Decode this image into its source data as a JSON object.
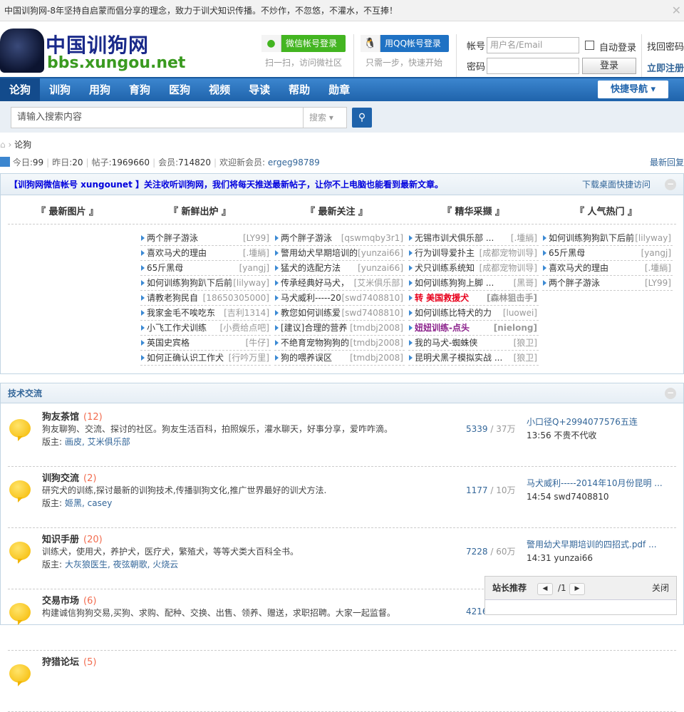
{
  "topbar": {
    "text": "中国训狗网-8年坚持自启蒙而倡分享的理念，致力于训犬知识传播。不炒作，不忽悠，不灌水，不互捧！"
  },
  "logo": {
    "cn": "中国训狗网",
    "domain": "bbs.xungou.net"
  },
  "social": {
    "wechat": "微信帐号登录",
    "wechat_sub": "扫一扫，访问微社区",
    "qq": "用QQ帐号登录",
    "qq_sub": "只需一步，快速开始"
  },
  "login": {
    "user_label": "帐号",
    "user_placeholder": "用户名/Email",
    "pass_label": "密码",
    "auto": "自动登录",
    "submit": "登录",
    "forgot": "找回密码",
    "register": "立即注册"
  },
  "nav": {
    "items": [
      "论狗",
      "训狗",
      "用狗",
      "育狗",
      "医狗",
      "视频",
      "导读",
      "帮助",
      "勋章"
    ],
    "quick": "快捷导航"
  },
  "search": {
    "placeholder": "请输入搜索内容",
    "type": "搜索"
  },
  "breadcrumb": {
    "current": "论狗"
  },
  "stats": {
    "today_label": "今日:",
    "today": "99",
    "yest_label": "昨日:",
    "yest": "20",
    "posts_label": "帖子:",
    "posts": "1969660",
    "members_label": "会员:",
    "members": "714820",
    "welcome": "欢迎新会员:",
    "newest": "ergeg98789",
    "latest": "最新回复"
  },
  "notice": {
    "text": "【训狗网微信帐号 xungounet 】关注收听训狗网，我们将每天推送最新帖子，让你不上电脑也能看到最新文章。",
    "download": "下载桌面快捷访问"
  },
  "columns": [
    {
      "title": "『 最新图片 』",
      "items": []
    },
    {
      "title": "『 新鲜出炉 』",
      "items": [
        [
          "两个胖子游泳",
          "[LY99]"
        ],
        [
          "喜欢马犬的理由",
          "[.堹緔]"
        ],
        [
          "65斤黑母",
          "[yangj]"
        ],
        [
          "如何训练狗狗趴下后前",
          "[lilyway]"
        ],
        [
          "请教老狗民自",
          "[18650305000]"
        ],
        [
          "我家金毛不唉吃东",
          "[吉利1314]"
        ],
        [
          "小飞工作犬训练",
          "[小费给点吧]"
        ],
        [
          "英国史宾格",
          "[牛仔]"
        ],
        [
          "如何正确认识工作犬",
          "[行吟万里]"
        ]
      ]
    },
    {
      "title": "『 最新关注 』",
      "items": [
        [
          "两个胖子游泳",
          "[qswmqby3r1]"
        ],
        [
          "警用幼犬早期培训的",
          "[yunzai66]"
        ],
        [
          "猛犬的选配方法",
          "[yunzai66]"
        ],
        [
          "传承经典好马犬，",
          "[艾米俱乐部]"
        ],
        [
          "马犬威利-----20",
          "[swd7408810]"
        ],
        [
          "教您如何训练爱",
          "[swd7408810]"
        ],
        [
          "[建议]合理的营养",
          "[tmdbj2008]"
        ],
        [
          "不绝育宠物狗狗的",
          "[tmdbj2008]"
        ],
        [
          "狗的喂养误区",
          "[tmdbj2008]"
        ]
      ]
    },
    {
      "title": "『 精华采撷 』",
      "items": [
        [
          "无锡市训犬俱乐部 ...",
          "[.堹緔]"
        ],
        [
          "行为训导爱扑主",
          "[成都宠物训导]"
        ],
        [
          "犬只训练系统知",
          "[成都宠物训导]"
        ],
        [
          "如何训练狗狗上脚 ...",
          "[黑哥]"
        ],
        [
          "转  美国救援犬",
          "[森林狙击手]",
          "#e8001c"
        ],
        [
          "如何训练比特犬的力",
          "[luowei]"
        ],
        [
          "妞妞训练-点头",
          "[nielong]",
          "#8a1f8a"
        ],
        [
          "我的马犬-蜘蛛侠",
          "[狼卫]"
        ],
        [
          "昆明犬黑子模拟实战 ...",
          "[狼卫]"
        ]
      ]
    },
    {
      "title": "『 人气热门 』",
      "items": [
        [
          "如何训练狗狗趴下后前",
          "[lilyway]"
        ],
        [
          "65斤黑母",
          "[yangj]"
        ],
        [
          "喜欢马犬的理由",
          "[.堹緔]"
        ],
        [
          "两个胖子游泳",
          "[LY99]"
        ]
      ]
    }
  ],
  "section": {
    "title": "技术交流",
    "mod_label": "版主:",
    "forums": [
      {
        "name": "狗友茶馆",
        "count": "(12)",
        "desc": "狗友聊狗、交流、探讨的社区。狗友生活百科，拍照娱乐，灌水聊天，好事分享，爱咋咋滴。",
        "mods": "画皮, 艾米俱乐部",
        "threads": "5339",
        "posts": "37万",
        "last_title": "小口径Q+2994077576五连",
        "last_meta": "13:56 不贵不代收"
      },
      {
        "name": "训狗交流",
        "count": "(2)",
        "desc": "研究犬的训练,探讨最新的训狗技术,传播驯狗文化,推广世界最好的训犬方法.",
        "mods": "姬黑, casey",
        "threads": "1177",
        "posts": "10万",
        "last_title": "马犬威利-----2014年10月份昆明 ...",
        "last_meta": "14:54 swd7408810"
      },
      {
        "name": "知识手册",
        "count": "(20)",
        "desc": "训练犬，使用犬，养护犬，医疗犬，繁殖犬，等等犬类大百科全书。",
        "mods": "大灰狼医生, 夜弦朝歌, 火烧云",
        "threads": "7228",
        "posts": "60万",
        "last_title": "警用幼犬早期培训的四招式.pdf ...",
        "last_meta": "14:31 yunzai66"
      },
      {
        "name": "交易市场",
        "count": "(6)",
        "desc": "构建诚信狗狗交易,买狗、求购、配种、交换、出售、领养、赠送，求职招聘。大家一起监督。",
        "threads": "4216"
      },
      {
        "name": "狩猎论坛",
        "count": "(5)"
      }
    ]
  },
  "popup": {
    "title": "站长推荐",
    "page": "/1",
    "close": "关闭"
  }
}
